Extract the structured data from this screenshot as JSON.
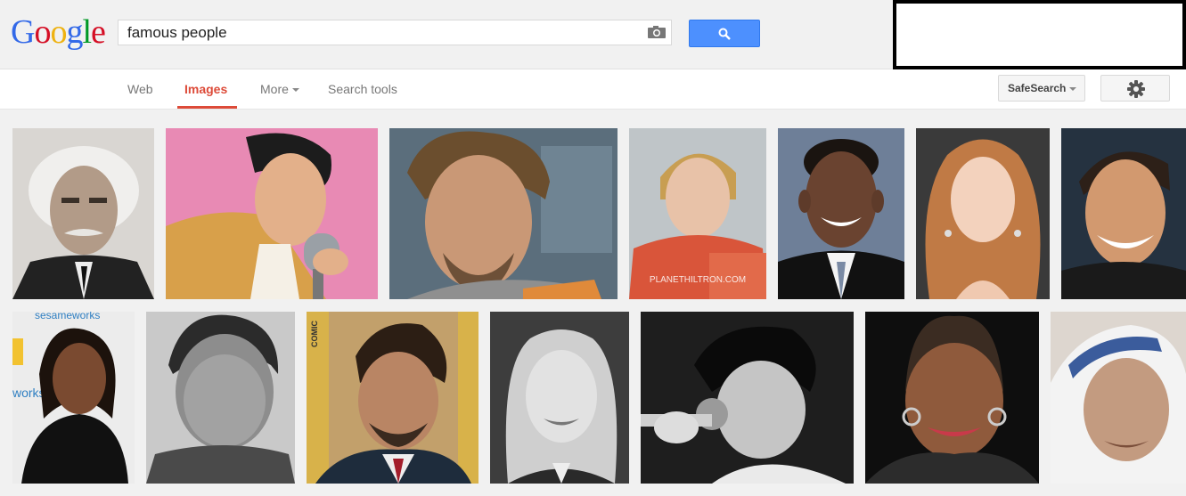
{
  "logo": {
    "text": "Google"
  },
  "search": {
    "query": "famous people"
  },
  "nav": {
    "web": "Web",
    "images": "Images",
    "more": "More",
    "search_tools": "Search tools"
  },
  "toolbar": {
    "safesearch": "SafeSearch"
  },
  "thumb_texts": {
    "planethiltron": "PLANETHILTRON.COM",
    "sesame": "sesameworks",
    "workshop": "workshop",
    "comic_con": "COMIC"
  },
  "results": [
    {
      "icon": "portrait-white-hair-man",
      "bg": "#d9d6d2"
    },
    {
      "icon": "painting-singer-microphone",
      "bg": "#e88ab4"
    },
    {
      "icon": "portrait-bearded-man",
      "bg": "#5b6e7c"
    },
    {
      "icon": "portrait-woman-red-top",
      "bg": "#bfc5c8"
    },
    {
      "icon": "portrait-man-suit",
      "bg": "#6e7f98"
    },
    {
      "icon": "portrait-woman-red-hair",
      "bg": "#3a3a3a"
    },
    {
      "icon": "portrait-smiling-man",
      "bg": "#253240"
    },
    {
      "icon": "portrait-woman-black-dress",
      "bg": "#ececec"
    },
    {
      "icon": "portrait-bw-man-jacket",
      "bg": "#c9c9c9"
    },
    {
      "icon": "portrait-man-comic-con",
      "bg": "#c2a06b"
    },
    {
      "icon": "portrait-bw-teen",
      "bg": "#3d3d3d"
    },
    {
      "icon": "portrait-bw-singer",
      "bg": "#1e1e1e"
    },
    {
      "icon": "portrait-woman-earrings",
      "bg": "#0e0e0e"
    },
    {
      "icon": "portrait-elderly-nun",
      "bg": "#ddd6cf"
    }
  ]
}
